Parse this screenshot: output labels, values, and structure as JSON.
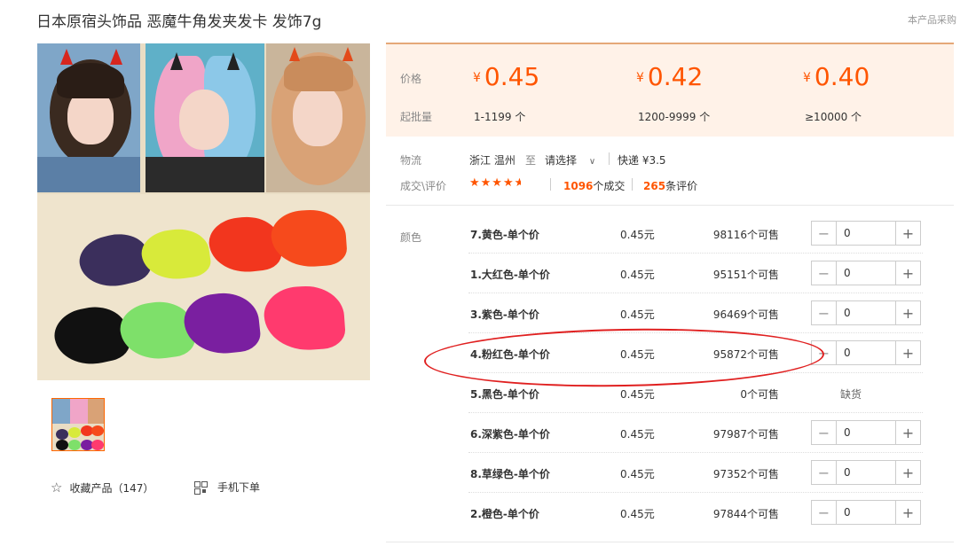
{
  "page": {
    "title": "日本原宿头饰品 恶魔牛角发夹发卡 发饰7g",
    "corner_note": "本产品采购"
  },
  "gallery": {
    "main_image_alt": "main-product-photo",
    "thumbnail_alt": "thumbnail"
  },
  "actions": {
    "favorite_label": "收藏产品（147）",
    "mobile_label": "手机下单"
  },
  "price_box": {
    "price_label": "价格",
    "min_label": "起批量",
    "currency": "¥",
    "tiers": [
      {
        "price": "0.45",
        "range": "1-1199 个"
      },
      {
        "price": "0.42",
        "range": "1200-9999 个"
      },
      {
        "price": "0.40",
        "range": "≥10000 个"
      }
    ]
  },
  "logistics": {
    "label": "物流",
    "origin": "浙江 温州",
    "to": "至",
    "destination": "请选择",
    "shipping": "快递 ¥3.5"
  },
  "reviews": {
    "label": "成交\\评价",
    "rating": 4.5,
    "deals_count": "1096",
    "deals_suffix": "个成交",
    "review_count": "265",
    "review_suffix": "条评价"
  },
  "colors": {
    "label": "颜色",
    "rows": [
      {
        "name": "7.黄色-单个价",
        "price": "0.45元",
        "stock": "98116个可售",
        "qty": "0",
        "available": true
      },
      {
        "name": "1.大红色-单个价",
        "price": "0.45元",
        "stock": "95151个可售",
        "qty": "0",
        "available": true
      },
      {
        "name": "3.紫色-单个价",
        "price": "0.45元",
        "stock": "96469个可售",
        "qty": "0",
        "available": true
      },
      {
        "name": "4.粉红色-单个价",
        "price": "0.45元",
        "stock": "95872个可售",
        "qty": "0",
        "available": true
      },
      {
        "name": "5.黑色-单个价",
        "price": "0.45元",
        "stock": "0个可售",
        "qty": "",
        "available": false,
        "soldout": "缺货"
      },
      {
        "name": "6.深紫色-单个价",
        "price": "0.45元",
        "stock": "97987个可售",
        "qty": "0",
        "available": true
      },
      {
        "name": "8.草绿色-单个价",
        "price": "0.45元",
        "stock": "97352个可售",
        "qty": "0",
        "available": true
      },
      {
        "name": "2.橙色-单个价",
        "price": "0.45元",
        "stock": "97844个可售",
        "qty": "0",
        "available": true
      }
    ]
  },
  "theme": {
    "accent": "#ff5500",
    "price_bg": "#fff2e8",
    "annotation": "#e02020"
  }
}
